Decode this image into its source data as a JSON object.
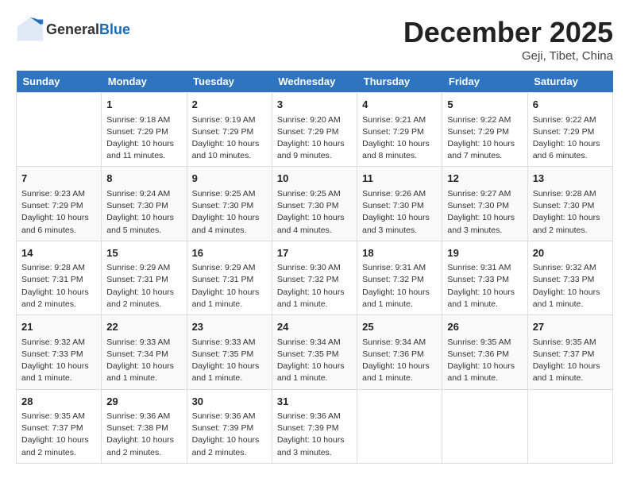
{
  "header": {
    "logo_line1": "General",
    "logo_line2": "Blue",
    "month_title": "December 2025",
    "location": "Geji, Tibet, China"
  },
  "days_of_week": [
    "Sunday",
    "Monday",
    "Tuesday",
    "Wednesday",
    "Thursday",
    "Friday",
    "Saturday"
  ],
  "weeks": [
    [
      {
        "day": "",
        "info": ""
      },
      {
        "day": "1",
        "info": "Sunrise: 9:18 AM\nSunset: 7:29 PM\nDaylight: 10 hours and 11 minutes."
      },
      {
        "day": "2",
        "info": "Sunrise: 9:19 AM\nSunset: 7:29 PM\nDaylight: 10 hours and 10 minutes."
      },
      {
        "day": "3",
        "info": "Sunrise: 9:20 AM\nSunset: 7:29 PM\nDaylight: 10 hours and 9 minutes."
      },
      {
        "day": "4",
        "info": "Sunrise: 9:21 AM\nSunset: 7:29 PM\nDaylight: 10 hours and 8 minutes."
      },
      {
        "day": "5",
        "info": "Sunrise: 9:22 AM\nSunset: 7:29 PM\nDaylight: 10 hours and 7 minutes."
      },
      {
        "day": "6",
        "info": "Sunrise: 9:22 AM\nSunset: 7:29 PM\nDaylight: 10 hours and 6 minutes."
      }
    ],
    [
      {
        "day": "7",
        "info": "Sunrise: 9:23 AM\nSunset: 7:29 PM\nDaylight: 10 hours and 6 minutes."
      },
      {
        "day": "8",
        "info": "Sunrise: 9:24 AM\nSunset: 7:30 PM\nDaylight: 10 hours and 5 minutes."
      },
      {
        "day": "9",
        "info": "Sunrise: 9:25 AM\nSunset: 7:30 PM\nDaylight: 10 hours and 4 minutes."
      },
      {
        "day": "10",
        "info": "Sunrise: 9:25 AM\nSunset: 7:30 PM\nDaylight: 10 hours and 4 minutes."
      },
      {
        "day": "11",
        "info": "Sunrise: 9:26 AM\nSunset: 7:30 PM\nDaylight: 10 hours and 3 minutes."
      },
      {
        "day": "12",
        "info": "Sunrise: 9:27 AM\nSunset: 7:30 PM\nDaylight: 10 hours and 3 minutes."
      },
      {
        "day": "13",
        "info": "Sunrise: 9:28 AM\nSunset: 7:30 PM\nDaylight: 10 hours and 2 minutes."
      }
    ],
    [
      {
        "day": "14",
        "info": "Sunrise: 9:28 AM\nSunset: 7:31 PM\nDaylight: 10 hours and 2 minutes."
      },
      {
        "day": "15",
        "info": "Sunrise: 9:29 AM\nSunset: 7:31 PM\nDaylight: 10 hours and 2 minutes."
      },
      {
        "day": "16",
        "info": "Sunrise: 9:29 AM\nSunset: 7:31 PM\nDaylight: 10 hours and 1 minute."
      },
      {
        "day": "17",
        "info": "Sunrise: 9:30 AM\nSunset: 7:32 PM\nDaylight: 10 hours and 1 minute."
      },
      {
        "day": "18",
        "info": "Sunrise: 9:31 AM\nSunset: 7:32 PM\nDaylight: 10 hours and 1 minute."
      },
      {
        "day": "19",
        "info": "Sunrise: 9:31 AM\nSunset: 7:33 PM\nDaylight: 10 hours and 1 minute."
      },
      {
        "day": "20",
        "info": "Sunrise: 9:32 AM\nSunset: 7:33 PM\nDaylight: 10 hours and 1 minute."
      }
    ],
    [
      {
        "day": "21",
        "info": "Sunrise: 9:32 AM\nSunset: 7:33 PM\nDaylight: 10 hours and 1 minute."
      },
      {
        "day": "22",
        "info": "Sunrise: 9:33 AM\nSunset: 7:34 PM\nDaylight: 10 hours and 1 minute."
      },
      {
        "day": "23",
        "info": "Sunrise: 9:33 AM\nSunset: 7:35 PM\nDaylight: 10 hours and 1 minute."
      },
      {
        "day": "24",
        "info": "Sunrise: 9:34 AM\nSunset: 7:35 PM\nDaylight: 10 hours and 1 minute."
      },
      {
        "day": "25",
        "info": "Sunrise: 9:34 AM\nSunset: 7:36 PM\nDaylight: 10 hours and 1 minute."
      },
      {
        "day": "26",
        "info": "Sunrise: 9:35 AM\nSunset: 7:36 PM\nDaylight: 10 hours and 1 minute."
      },
      {
        "day": "27",
        "info": "Sunrise: 9:35 AM\nSunset: 7:37 PM\nDaylight: 10 hours and 1 minute."
      }
    ],
    [
      {
        "day": "28",
        "info": "Sunrise: 9:35 AM\nSunset: 7:37 PM\nDaylight: 10 hours and 2 minutes."
      },
      {
        "day": "29",
        "info": "Sunrise: 9:36 AM\nSunset: 7:38 PM\nDaylight: 10 hours and 2 minutes."
      },
      {
        "day": "30",
        "info": "Sunrise: 9:36 AM\nSunset: 7:39 PM\nDaylight: 10 hours and 2 minutes."
      },
      {
        "day": "31",
        "info": "Sunrise: 9:36 AM\nSunset: 7:39 PM\nDaylight: 10 hours and 3 minutes."
      },
      {
        "day": "",
        "info": ""
      },
      {
        "day": "",
        "info": ""
      },
      {
        "day": "",
        "info": ""
      }
    ]
  ]
}
